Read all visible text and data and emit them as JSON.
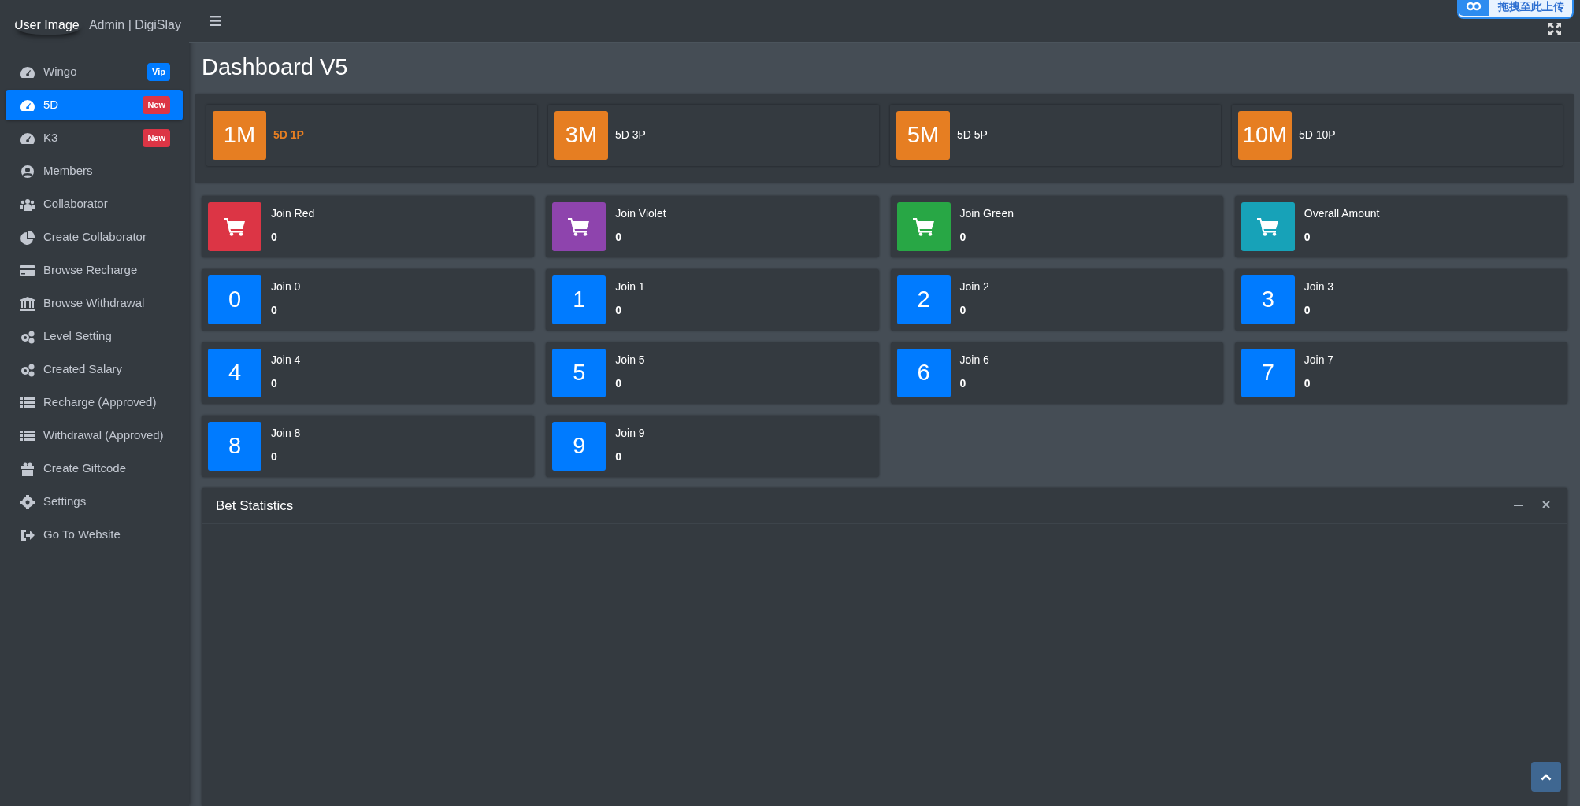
{
  "sidebar": {
    "user_image": "User Image",
    "user_name": "Admin | DigiSlay",
    "items": [
      {
        "label": "Wingo",
        "badge": {
          "text": "Vip",
          "color": "#007bff"
        },
        "selected": false
      },
      {
        "label": "5D",
        "badge": {
          "text": "New",
          "color": "#dc3545"
        },
        "selected": true
      },
      {
        "label": "K3",
        "badge": {
          "text": "New",
          "color": "#dc3545"
        },
        "selected": false
      },
      {
        "label": "Members",
        "selected": false
      },
      {
        "label": "Collaborator",
        "selected": false
      },
      {
        "label": "Create Collaborator",
        "selected": false
      },
      {
        "label": "Browse Recharge",
        "selected": false
      },
      {
        "label": "Browse Withdrawal",
        "selected": false
      },
      {
        "label": "Level Setting",
        "selected": false
      },
      {
        "label": "Created Salary",
        "selected": false
      },
      {
        "label": "Recharge (Approved)",
        "selected": false
      },
      {
        "label": "Withdrawal (Approved)",
        "selected": false
      },
      {
        "label": "Create Giftcode",
        "selected": false
      },
      {
        "label": "Settings",
        "selected": false
      },
      {
        "label": "Go To Website",
        "selected": false
      }
    ]
  },
  "upload_overlay": {
    "label": "拖拽至此上传"
  },
  "page_title": "Dashboard V5",
  "periods": [
    {
      "badge": "1M",
      "label": "5D 1P",
      "selected": true
    },
    {
      "badge": "3M",
      "label": "5D 3P",
      "selected": false
    },
    {
      "badge": "5M",
      "label": "5D 5P",
      "selected": false
    },
    {
      "badge": "10M",
      "label": "5D 10P",
      "selected": false
    }
  ],
  "stats": [
    {
      "kind": "cart",
      "color": "#dc3545",
      "label": "Join Red",
      "value": "0"
    },
    {
      "kind": "cart",
      "color": "#8e44ad",
      "label": "Join Violet",
      "value": "0"
    },
    {
      "kind": "cart",
      "color": "#28a745",
      "label": "Join Green",
      "value": "0"
    },
    {
      "kind": "cart",
      "color": "#17a2b8",
      "label": "Overall Amount",
      "value": "0"
    },
    {
      "kind": "number",
      "color": "#007bff",
      "badge": "0",
      "label": "Join 0",
      "value": "0"
    },
    {
      "kind": "number",
      "color": "#007bff",
      "badge": "1",
      "label": "Join 1",
      "value": "0"
    },
    {
      "kind": "number",
      "color": "#007bff",
      "badge": "2",
      "label": "Join 2",
      "value": "0"
    },
    {
      "kind": "number",
      "color": "#007bff",
      "badge": "3",
      "label": "Join 3",
      "value": "0"
    },
    {
      "kind": "number",
      "color": "#007bff",
      "badge": "4",
      "label": "Join 4",
      "value": "0"
    },
    {
      "kind": "number",
      "color": "#007bff",
      "badge": "5",
      "label": "Join 5",
      "value": "0"
    },
    {
      "kind": "number",
      "color": "#007bff",
      "badge": "6",
      "label": "Join 6",
      "value": "0"
    },
    {
      "kind": "number",
      "color": "#007bff",
      "badge": "7",
      "label": "Join 7",
      "value": "0"
    },
    {
      "kind": "number",
      "color": "#007bff",
      "badge": "8",
      "label": "Join 8",
      "value": "0"
    },
    {
      "kind": "number",
      "color": "#007bff",
      "badge": "9",
      "label": "Join 9",
      "value": "0"
    }
  ],
  "bet_statistics": {
    "title": "Bet Statistics"
  }
}
